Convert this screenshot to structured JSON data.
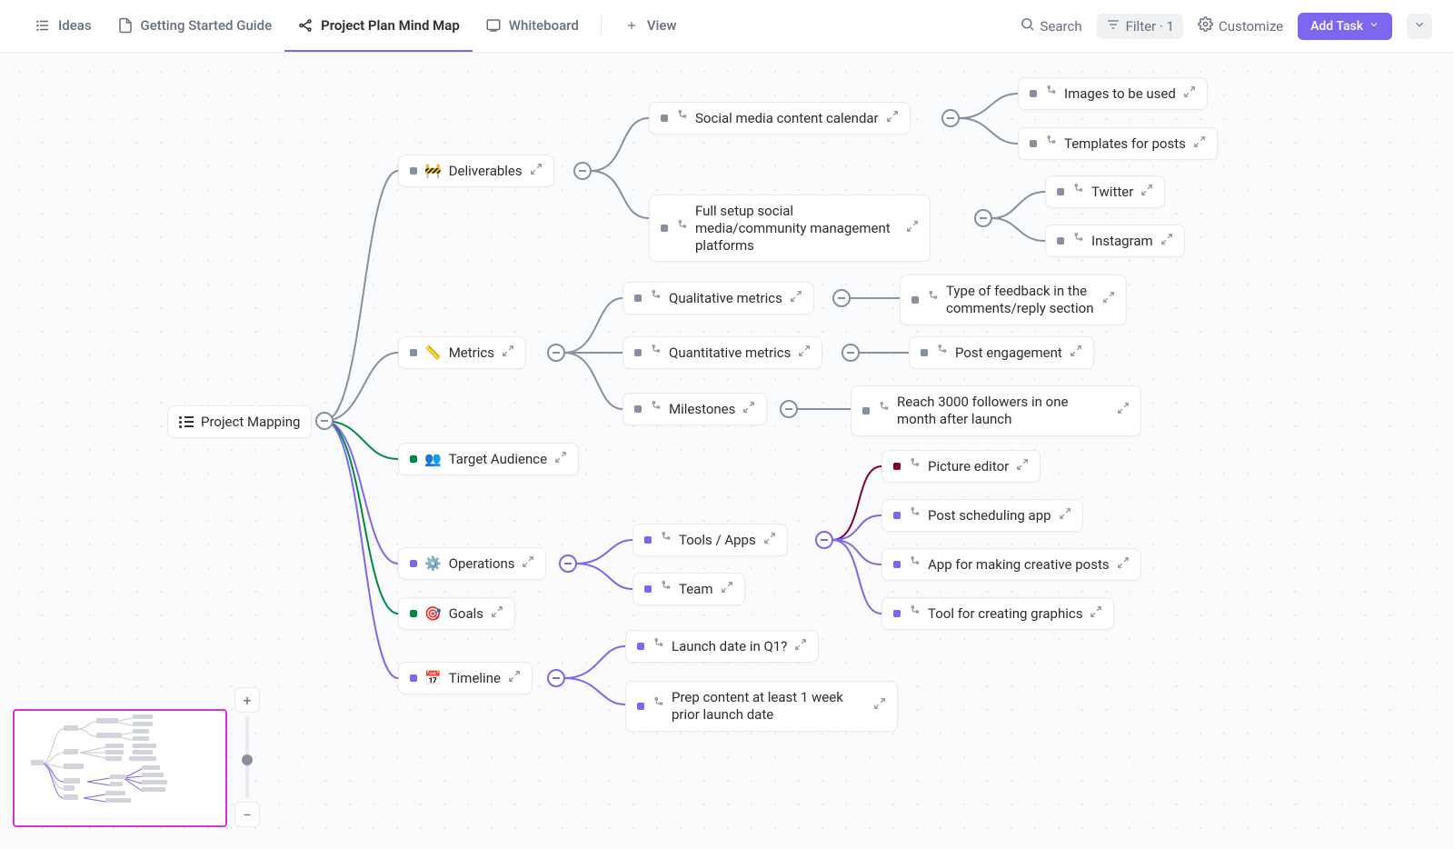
{
  "header": {
    "tabs": [
      {
        "label": "Ideas"
      },
      {
        "label": "Getting Started Guide"
      },
      {
        "label": "Project Plan Mind Map"
      },
      {
        "label": "Whiteboard"
      }
    ],
    "view_label": "View",
    "search_label": "Search",
    "filter_label": "Filter · 1",
    "customize_label": "Customize",
    "add_task_label": "Add Task"
  },
  "root": {
    "label": "Project Mapping"
  },
  "l1": {
    "deliverables": "Deliverables",
    "metrics": "Metrics",
    "target_audience": "Target Audience",
    "operations": "Operations",
    "goals": "Goals",
    "timeline": "Timeline",
    "deliverables_emoji": "🚧",
    "metrics_emoji": "📏",
    "target_emoji": "👥",
    "operations_emoji": "⚙️",
    "goals_emoji": "🎯",
    "timeline_emoji": "📅"
  },
  "deliv": {
    "calendar": "Social media content calendar",
    "fullsetup": "Full setup social media/community management platforms",
    "images": "Images to be used",
    "templates": "Templates for posts",
    "twitter": "Twitter",
    "instagram": "Instagram"
  },
  "metrics": {
    "qual": "Qualitative metrics",
    "quant": "Quantitative metrics",
    "milestones": "Milestones",
    "qual_child": "Type of feedback in the comments/reply section",
    "quant_child": "Post engagement",
    "milestones_child": "Reach 3000 followers in one month after launch"
  },
  "ops": {
    "tools": "Tools / Apps",
    "team": "Team",
    "pic_editor": "Picture editor",
    "scheduler": "Post scheduling app",
    "creative": "App for making creative posts",
    "graphics": "Tool for creating graphics"
  },
  "timeline": {
    "launch": "Launch date in Q1?",
    "prep": "Prep content at least 1 week prior launch date"
  }
}
